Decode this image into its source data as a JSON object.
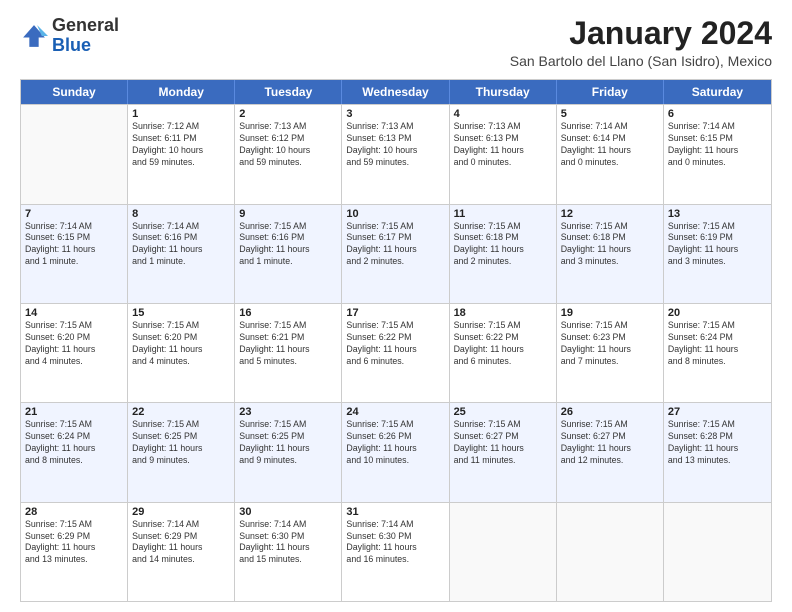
{
  "logo": {
    "general": "General",
    "blue": "Blue"
  },
  "title": "January 2024",
  "subtitle": "San Bartolo del Llano (San Isidro), Mexico",
  "header_days": [
    "Sunday",
    "Monday",
    "Tuesday",
    "Wednesday",
    "Thursday",
    "Friday",
    "Saturday"
  ],
  "weeks": [
    [
      {
        "num": "",
        "info": "",
        "shaded": false,
        "empty": true
      },
      {
        "num": "1",
        "info": "Sunrise: 7:12 AM\nSunset: 6:11 PM\nDaylight: 10 hours\nand 59 minutes.",
        "shaded": false,
        "empty": false
      },
      {
        "num": "2",
        "info": "Sunrise: 7:13 AM\nSunset: 6:12 PM\nDaylight: 10 hours\nand 59 minutes.",
        "shaded": false,
        "empty": false
      },
      {
        "num": "3",
        "info": "Sunrise: 7:13 AM\nSunset: 6:13 PM\nDaylight: 10 hours\nand 59 minutes.",
        "shaded": false,
        "empty": false
      },
      {
        "num": "4",
        "info": "Sunrise: 7:13 AM\nSunset: 6:13 PM\nDaylight: 11 hours\nand 0 minutes.",
        "shaded": false,
        "empty": false
      },
      {
        "num": "5",
        "info": "Sunrise: 7:14 AM\nSunset: 6:14 PM\nDaylight: 11 hours\nand 0 minutes.",
        "shaded": false,
        "empty": false
      },
      {
        "num": "6",
        "info": "Sunrise: 7:14 AM\nSunset: 6:15 PM\nDaylight: 11 hours\nand 0 minutes.",
        "shaded": false,
        "empty": false
      }
    ],
    [
      {
        "num": "7",
        "info": "Sunrise: 7:14 AM\nSunset: 6:15 PM\nDaylight: 11 hours\nand 1 minute.",
        "shaded": true,
        "empty": false
      },
      {
        "num": "8",
        "info": "Sunrise: 7:14 AM\nSunset: 6:16 PM\nDaylight: 11 hours\nand 1 minute.",
        "shaded": true,
        "empty": false
      },
      {
        "num": "9",
        "info": "Sunrise: 7:15 AM\nSunset: 6:16 PM\nDaylight: 11 hours\nand 1 minute.",
        "shaded": true,
        "empty": false
      },
      {
        "num": "10",
        "info": "Sunrise: 7:15 AM\nSunset: 6:17 PM\nDaylight: 11 hours\nand 2 minutes.",
        "shaded": true,
        "empty": false
      },
      {
        "num": "11",
        "info": "Sunrise: 7:15 AM\nSunset: 6:18 PM\nDaylight: 11 hours\nand 2 minutes.",
        "shaded": true,
        "empty": false
      },
      {
        "num": "12",
        "info": "Sunrise: 7:15 AM\nSunset: 6:18 PM\nDaylight: 11 hours\nand 3 minutes.",
        "shaded": true,
        "empty": false
      },
      {
        "num": "13",
        "info": "Sunrise: 7:15 AM\nSunset: 6:19 PM\nDaylight: 11 hours\nand 3 minutes.",
        "shaded": true,
        "empty": false
      }
    ],
    [
      {
        "num": "14",
        "info": "Sunrise: 7:15 AM\nSunset: 6:20 PM\nDaylight: 11 hours\nand 4 minutes.",
        "shaded": false,
        "empty": false
      },
      {
        "num": "15",
        "info": "Sunrise: 7:15 AM\nSunset: 6:20 PM\nDaylight: 11 hours\nand 4 minutes.",
        "shaded": false,
        "empty": false
      },
      {
        "num": "16",
        "info": "Sunrise: 7:15 AM\nSunset: 6:21 PM\nDaylight: 11 hours\nand 5 minutes.",
        "shaded": false,
        "empty": false
      },
      {
        "num": "17",
        "info": "Sunrise: 7:15 AM\nSunset: 6:22 PM\nDaylight: 11 hours\nand 6 minutes.",
        "shaded": false,
        "empty": false
      },
      {
        "num": "18",
        "info": "Sunrise: 7:15 AM\nSunset: 6:22 PM\nDaylight: 11 hours\nand 6 minutes.",
        "shaded": false,
        "empty": false
      },
      {
        "num": "19",
        "info": "Sunrise: 7:15 AM\nSunset: 6:23 PM\nDaylight: 11 hours\nand 7 minutes.",
        "shaded": false,
        "empty": false
      },
      {
        "num": "20",
        "info": "Sunrise: 7:15 AM\nSunset: 6:24 PM\nDaylight: 11 hours\nand 8 minutes.",
        "shaded": false,
        "empty": false
      }
    ],
    [
      {
        "num": "21",
        "info": "Sunrise: 7:15 AM\nSunset: 6:24 PM\nDaylight: 11 hours\nand 8 minutes.",
        "shaded": true,
        "empty": false
      },
      {
        "num": "22",
        "info": "Sunrise: 7:15 AM\nSunset: 6:25 PM\nDaylight: 11 hours\nand 9 minutes.",
        "shaded": true,
        "empty": false
      },
      {
        "num": "23",
        "info": "Sunrise: 7:15 AM\nSunset: 6:25 PM\nDaylight: 11 hours\nand 9 minutes.",
        "shaded": true,
        "empty": false
      },
      {
        "num": "24",
        "info": "Sunrise: 7:15 AM\nSunset: 6:26 PM\nDaylight: 11 hours\nand 10 minutes.",
        "shaded": true,
        "empty": false
      },
      {
        "num": "25",
        "info": "Sunrise: 7:15 AM\nSunset: 6:27 PM\nDaylight: 11 hours\nand 11 minutes.",
        "shaded": true,
        "empty": false
      },
      {
        "num": "26",
        "info": "Sunrise: 7:15 AM\nSunset: 6:27 PM\nDaylight: 11 hours\nand 12 minutes.",
        "shaded": true,
        "empty": false
      },
      {
        "num": "27",
        "info": "Sunrise: 7:15 AM\nSunset: 6:28 PM\nDaylight: 11 hours\nand 13 minutes.",
        "shaded": true,
        "empty": false
      }
    ],
    [
      {
        "num": "28",
        "info": "Sunrise: 7:15 AM\nSunset: 6:29 PM\nDaylight: 11 hours\nand 13 minutes.",
        "shaded": false,
        "empty": false
      },
      {
        "num": "29",
        "info": "Sunrise: 7:14 AM\nSunset: 6:29 PM\nDaylight: 11 hours\nand 14 minutes.",
        "shaded": false,
        "empty": false
      },
      {
        "num": "30",
        "info": "Sunrise: 7:14 AM\nSunset: 6:30 PM\nDaylight: 11 hours\nand 15 minutes.",
        "shaded": false,
        "empty": false
      },
      {
        "num": "31",
        "info": "Sunrise: 7:14 AM\nSunset: 6:30 PM\nDaylight: 11 hours\nand 16 minutes.",
        "shaded": false,
        "empty": false
      },
      {
        "num": "",
        "info": "",
        "shaded": false,
        "empty": true
      },
      {
        "num": "",
        "info": "",
        "shaded": false,
        "empty": true
      },
      {
        "num": "",
        "info": "",
        "shaded": false,
        "empty": true
      }
    ]
  ]
}
